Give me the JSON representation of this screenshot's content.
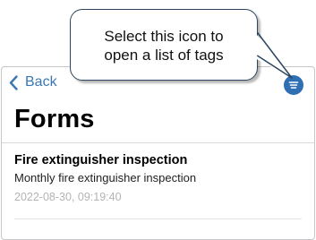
{
  "callout": {
    "line1": "Select this icon to",
    "line2": "open a list of tags"
  },
  "nav": {
    "back_label": "Back"
  },
  "page": {
    "title": "Forms"
  },
  "forms": [
    {
      "title": "Fire extinguisher inspection",
      "description": "Monthly fire extinguisher inspection",
      "date": "2022-08-30, 09:19:40"
    }
  ],
  "colors": {
    "accent": "#3a78b4",
    "tag_button": "#2f6fb4",
    "date_text": "#b3b3b3"
  },
  "icons": {
    "back": "chevron-left-icon",
    "tags": "filter-lines-icon"
  }
}
